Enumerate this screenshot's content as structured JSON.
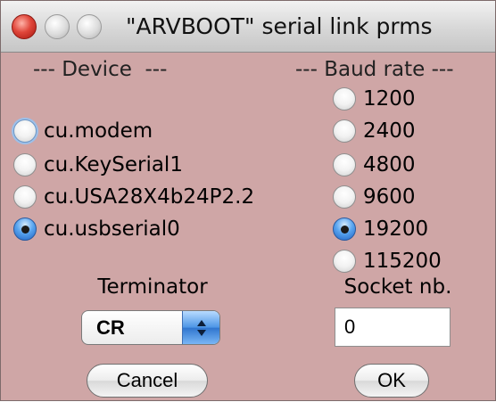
{
  "window": {
    "title": "\"ARVBOOT\" serial link prms",
    "background": "#cfa6a6"
  },
  "device": {
    "header": "--- Device  ---",
    "options": [
      {
        "label": "cu.modem",
        "checked": false,
        "focused": true
      },
      {
        "label": "cu.KeySerial1",
        "checked": false
      },
      {
        "label": "cu.USA28X4b24P2.2",
        "checked": false
      },
      {
        "label": "cu.usbserial0",
        "checked": true
      }
    ]
  },
  "baud": {
    "header": "--- Baud rate ---",
    "options": [
      {
        "label": "1200",
        "checked": false
      },
      {
        "label": "2400",
        "checked": false
      },
      {
        "label": "4800",
        "checked": false
      },
      {
        "label": "9600",
        "checked": false
      },
      {
        "label": "19200",
        "checked": true
      },
      {
        "label": "115200",
        "checked": false
      }
    ]
  },
  "terminator": {
    "label": "Terminator",
    "value": "CR",
    "icon": "up-down-arrows-icon"
  },
  "socket": {
    "label": "Socket nb.",
    "value": "0"
  },
  "buttons": {
    "cancel": "Cancel",
    "ok": "OK"
  }
}
